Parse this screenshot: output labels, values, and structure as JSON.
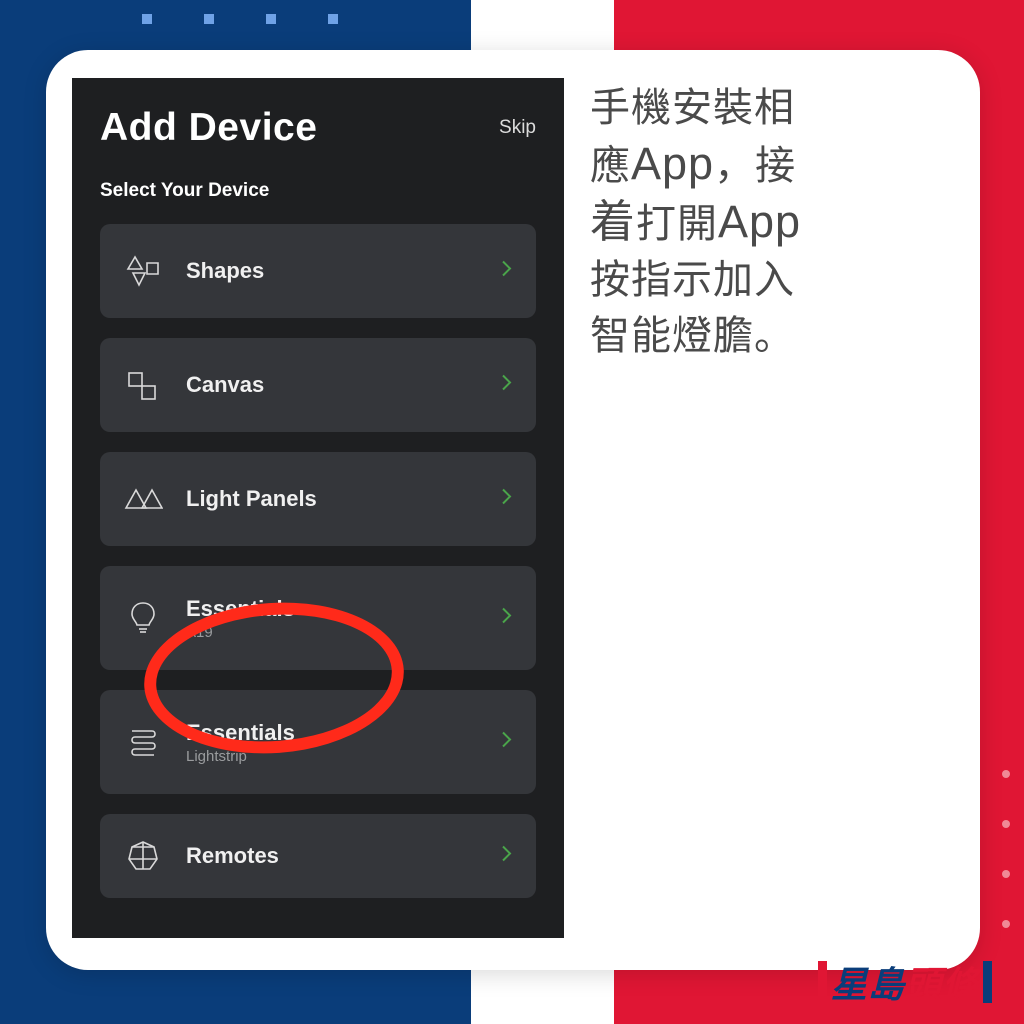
{
  "phone": {
    "title": "Add Device",
    "skip": "Skip",
    "subtitle": "Select Your Device",
    "rows": [
      {
        "label": "Shapes",
        "sub": ""
      },
      {
        "label": "Canvas",
        "sub": ""
      },
      {
        "label": "Light Panels",
        "sub": ""
      },
      {
        "label": "Essentials",
        "sub": "A19"
      },
      {
        "label": "Essentials",
        "sub": "Lightstrip"
      },
      {
        "label": "Remotes",
        "sub": ""
      }
    ]
  },
  "caption": {
    "l1a": "手機安裝相",
    "l2a": "應",
    "l2b": "App",
    "l2c": "，接",
    "l3a": "着",
    "l3b": "打開",
    "l3c": "App",
    "l4": "按指示加入",
    "l5": "智能燈膽。"
  },
  "brand": {
    "a": "星島",
    "b": "頭條"
  }
}
